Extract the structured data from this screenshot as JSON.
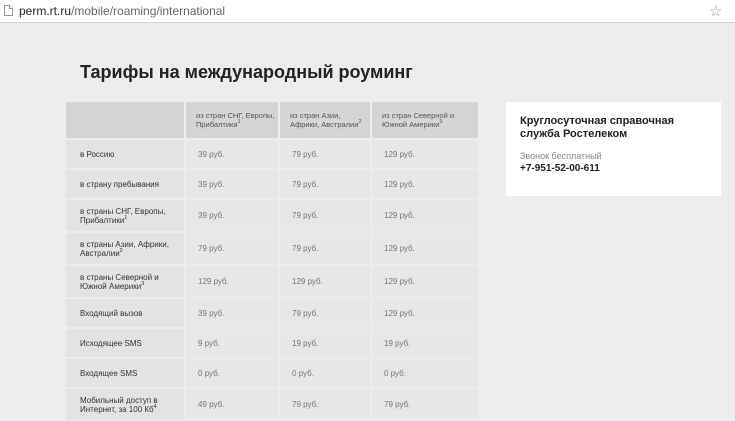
{
  "browser": {
    "url_host": "perm.rt.ru",
    "url_path": "/mobile/roaming/international"
  },
  "page": {
    "title": "Тарифы на международный роуминг"
  },
  "table": {
    "headers": [
      {
        "text": "из стран СНГ, Европы, Прибалтики",
        "sup": "1"
      },
      {
        "text": "из стран Азии, Африки, Австралии",
        "sup": "2"
      },
      {
        "text": "из стран Северной и Южной Америки",
        "sup": "3"
      }
    ],
    "rows": [
      {
        "label": "в Россию",
        "sup": "",
        "values": [
          "39 руб.",
          "79 руб.",
          "129 руб."
        ]
      },
      {
        "label": "в страну пребывания",
        "sup": "",
        "values": [
          "39 руб.",
          "79 руб.",
          "129 руб."
        ]
      },
      {
        "label": "в страны СНГ, Европы, Прибалтики",
        "sup": "1",
        "values": [
          "39 руб.",
          "79 руб.",
          "129 руб."
        ]
      },
      {
        "label": "в страны Азии, Африки, Австралии",
        "sup": "2",
        "values": [
          "79 руб.",
          "79 руб.",
          "129 руб."
        ]
      },
      {
        "label": "в страны Северной и Южной Америки",
        "sup": "3",
        "values": [
          "129 руб.",
          "129 руб.",
          "129 руб."
        ]
      },
      {
        "label": "Входящий вызов",
        "sup": "",
        "values": [
          "39 руб.",
          "79 руб.",
          "129 руб."
        ]
      },
      {
        "label": "Исходящее SMS",
        "sup": "",
        "values": [
          "9 руб.",
          "19 руб.",
          "19 руб."
        ]
      },
      {
        "label": "Входящее SMS",
        "sup": "",
        "values": [
          "0 руб.",
          "0 руб.",
          "0 руб."
        ]
      },
      {
        "label": "Мобильный доступ в Интернет, за 100 Кб",
        "sup": "4",
        "values": [
          "49 руб.",
          "79 руб.",
          "79 руб."
        ]
      }
    ]
  },
  "support": {
    "title": "Круглосуточная справочная служба Ростелеком",
    "call_note": "Звонок бесплатный",
    "phone": "+7-951-52-00-611"
  },
  "icons": {
    "page": "page-icon",
    "bookmark": "star-icon"
  }
}
